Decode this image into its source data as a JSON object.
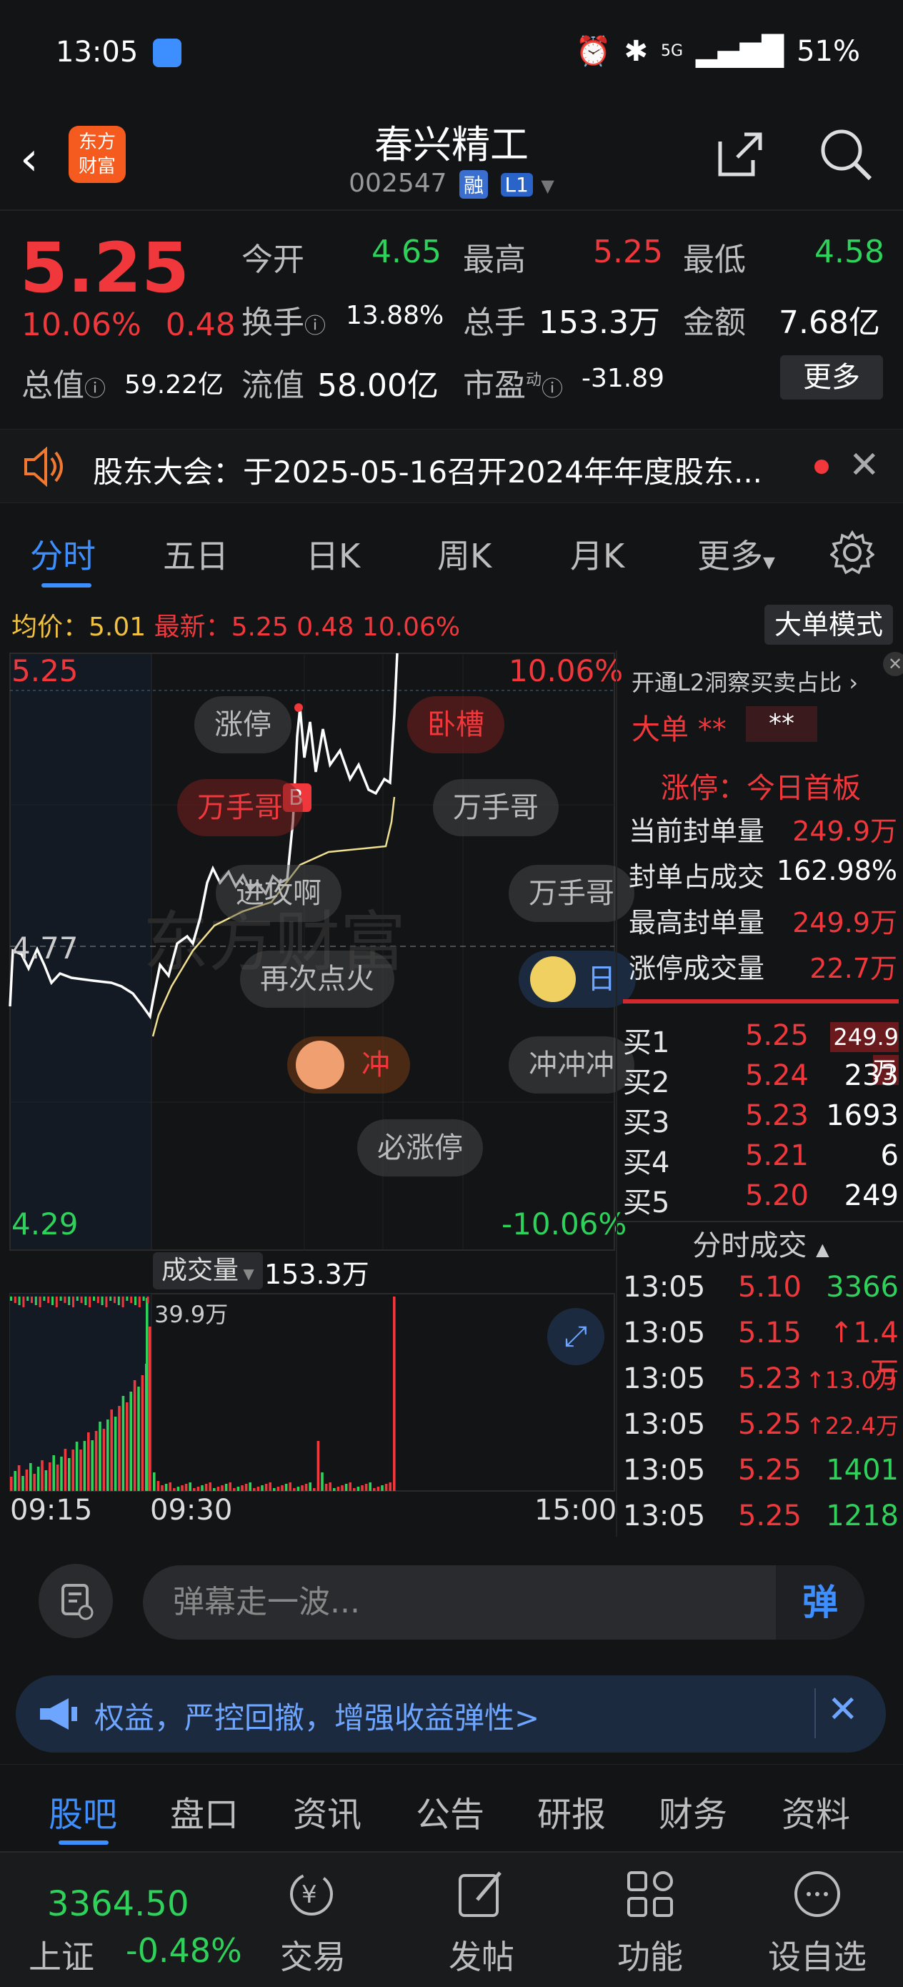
{
  "status_bar": {
    "time": "13:05",
    "network": "5G",
    "battery": "51%"
  },
  "header": {
    "title": "春兴精工",
    "code": "002547",
    "tag_margin": "融",
    "tag_level": "L1",
    "logo_line1": "东方",
    "logo_line2": "财富"
  },
  "quote": {
    "price": "5.25",
    "change_pct": "10.06%",
    "change": "0.48",
    "open_label": "今开",
    "open": "4.65",
    "high_label": "最高",
    "high": "5.25",
    "low_label": "最低",
    "low": "4.58",
    "turnover_label": "换手",
    "turnover": "13.88%",
    "volume_label": "总手",
    "volume": "153.3万",
    "amount_label": "金额",
    "amount": "7.68亿",
    "mktcap_label": "总值",
    "mktcap": "59.22亿",
    "float_label": "流值",
    "float": "58.00亿",
    "pe_label": "市盈",
    "pe_sup": "动",
    "pe": "-31.89",
    "more": "更多"
  },
  "notice": {
    "text": "股东大会：于2025-05-16召开2024年年度股东..."
  },
  "tabs": [
    "分时",
    "五日",
    "日K",
    "周K",
    "月K",
    "更多"
  ],
  "info_line": {
    "avg_label": "均价：",
    "avg": "5.01",
    "latest_label": "最新：",
    "latest": "5.25",
    "chg": "0.48",
    "pct": "10.06%",
    "big_order_mode": "大单模式"
  },
  "chart": {
    "price_high": "5.25",
    "price_mid": "4.77",
    "price_low": "4.29",
    "pct_high": "10.06%",
    "pct_low": "-10.06%",
    "volume_label": "成交量",
    "volume_total": "153.3万",
    "volume_max": "39.9万",
    "time_start": "09:15",
    "time_open": "09:30",
    "time_end": "15:00",
    "watermark": "东方财富",
    "b_marker": "B",
    "danmu": [
      "涨停",
      "卧槽",
      "万手哥",
      "万手哥",
      "进攻啊",
      "万手哥",
      "再次点火",
      "日",
      "冲",
      "冲冲冲",
      "必涨停"
    ]
  },
  "chart_data": {
    "type": "line",
    "x": [
      "09:15",
      "09:30",
      "15:00"
    ],
    "ylim": [
      4.29,
      5.25
    ],
    "reference": 4.77,
    "series": [],
    "volume_ylim_label": "39.9万"
  },
  "side": {
    "l2_label": "开通L2洞察买卖占比",
    "big_order_label": "大单",
    "big_order_stars": "**",
    "big_order_value": "**",
    "limit_title": "涨停：今日首板",
    "seal_rows": [
      {
        "k": "当前封单量",
        "v": "249.9万"
      },
      {
        "k": "封单占成交",
        "v": "162.98%"
      },
      {
        "k": "最高封单量",
        "v": "249.9万"
      },
      {
        "k": "涨停成交量",
        "v": "22.7万"
      }
    ],
    "order_book": [
      {
        "name": "买1",
        "price": "5.25",
        "qty": "249.9万"
      },
      {
        "name": "买2",
        "price": "5.24",
        "qty": "233"
      },
      {
        "name": "买3",
        "price": "5.23",
        "qty": "1693"
      },
      {
        "name": "买4",
        "price": "5.21",
        "qty": "6"
      },
      {
        "name": "买5",
        "price": "5.20",
        "qty": "249"
      }
    ],
    "ticks_label": "分时成交",
    "ticks": [
      {
        "time": "13:05",
        "price": "5.10",
        "qty": "3366",
        "color": "#2ed15a"
      },
      {
        "time": "13:05",
        "price": "5.15",
        "qty": "↑1.4万",
        "color": "#f0383c"
      },
      {
        "time": "13:05",
        "price": "5.23",
        "qty": "↑13.0万",
        "color": "#f0383c"
      },
      {
        "time": "13:05",
        "price": "5.25",
        "qty": "↑22.4万",
        "color": "#f0383c"
      },
      {
        "time": "13:05",
        "price": "5.25",
        "qty": "1401",
        "color": "#2ed15a"
      },
      {
        "time": "13:05",
        "price": "5.25",
        "qty": "1218",
        "color": "#2ed15a"
      }
    ]
  },
  "danmu_bar": {
    "placeholder": "弹幕走一波...",
    "send": "弹"
  },
  "promo": {
    "text": "权益，严控回撤，增强收益弹性>"
  },
  "bottom_tabs": [
    "股吧",
    "盘口",
    "资讯",
    "公告",
    "研报",
    "财务",
    "资料"
  ],
  "nav": {
    "index_value": "3364.50",
    "index_name": "上证",
    "index_change": "-0.48%",
    "items": [
      "交易",
      "发帖",
      "功能",
      "设自选"
    ]
  },
  "colors": {
    "up": "#f0383c",
    "down": "#2ed15a",
    "accent": "#3d8fff",
    "background": "#131416"
  }
}
